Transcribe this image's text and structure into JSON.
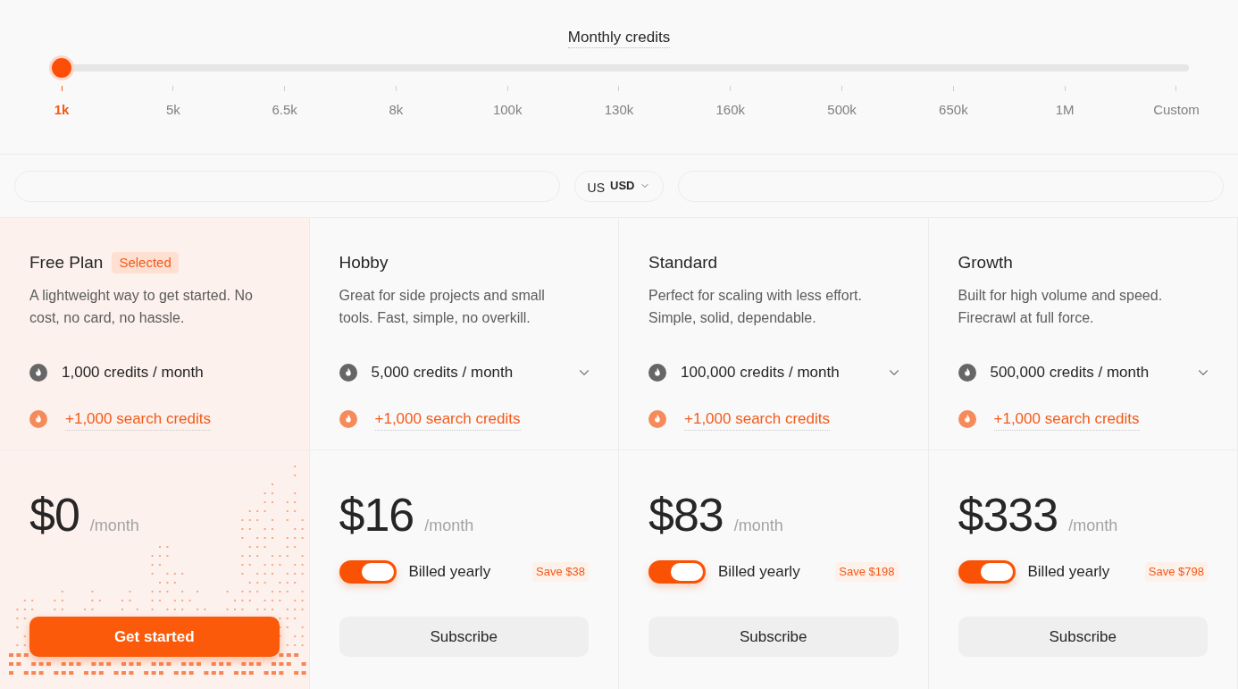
{
  "credits_slider": {
    "label": "Monthly credits",
    "level": 0,
    "marks": [
      {
        "label": "1k",
        "selected": true
      },
      {
        "label": "5k",
        "selected": false
      },
      {
        "label": "6.5k",
        "selected": false
      },
      {
        "label": "8k",
        "selected": false
      },
      {
        "label": "100k",
        "selected": false
      },
      {
        "label": "130k",
        "selected": false
      },
      {
        "label": "160k",
        "selected": false
      },
      {
        "label": "500k",
        "selected": false
      },
      {
        "label": "650k",
        "selected": false
      },
      {
        "label": "1M",
        "selected": false
      },
      {
        "label": "Custom",
        "selected": false
      }
    ]
  },
  "currency": {
    "flag": "US",
    "code": "USD"
  },
  "plans": [
    {
      "name": "Free Plan",
      "badge": "Selected",
      "selected": true,
      "description": "A lightweight way to get started. No cost, no card, no hassle.",
      "credits": "1,000 credits / month",
      "credits_dropdown": false,
      "search_credits": "+1,000 search credits",
      "price": "$0",
      "period": "/month",
      "button": "Get started"
    },
    {
      "name": "Hobby",
      "selected": false,
      "description": "Great for side projects and small tools. Fast, simple, no overkill.",
      "credits": "5,000 credits / month",
      "credits_dropdown": true,
      "search_credits": "+1,000 search credits",
      "price": "$16",
      "period": "/month",
      "billing": {
        "label": "Billed yearly",
        "on": true,
        "savings": "Save $38"
      },
      "button": "Subscribe"
    },
    {
      "name": "Standard",
      "selected": false,
      "description": "Perfect for scaling with less effort. Simple, solid, dependable.",
      "credits": "100,000 credits / month",
      "credits_dropdown": true,
      "search_credits": "+1,000 search credits",
      "price": "$83",
      "period": "/month",
      "billing": {
        "label": "Billed yearly",
        "on": true,
        "savings": "Save $198"
      },
      "button": "Subscribe"
    },
    {
      "name": "Growth",
      "selected": false,
      "description": "Built for high volume and speed. Firecrawl at full force.",
      "credits": "500,000 credits / month",
      "credits_dropdown": true,
      "search_credits": "+1,000 search credits",
      "price": "$333",
      "period": "/month",
      "billing": {
        "label": "Billed yearly",
        "on": true,
        "savings": "Save $798"
      },
      "button": "Subscribe"
    }
  ]
}
